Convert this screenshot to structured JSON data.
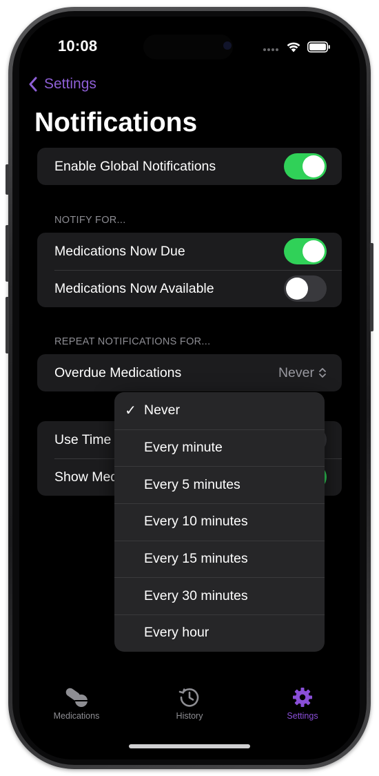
{
  "status_bar": {
    "time": "10:08"
  },
  "nav": {
    "back_label": "Settings",
    "title": "Notifications"
  },
  "global": {
    "enable_label": "Enable Global Notifications",
    "enabled": true
  },
  "notify_for": {
    "header": "NOTIFY FOR...",
    "items": [
      {
        "label": "Medications Now Due",
        "enabled": true
      },
      {
        "label": "Medications Now Available",
        "enabled": false
      }
    ]
  },
  "repeat": {
    "header": "REPEAT NOTIFICATIONS FOR...",
    "overdue_label": "Overdue Medications",
    "selected_value": "Never"
  },
  "other": {
    "items": [
      {
        "label": "Use Time",
        "enabled": false
      },
      {
        "label": "Show Med",
        "enabled": true
      }
    ]
  },
  "dropdown": {
    "options": [
      {
        "label": "Never",
        "selected": true
      },
      {
        "label": "Every minute",
        "selected": false
      },
      {
        "label": "Every 5 minutes",
        "selected": false
      },
      {
        "label": "Every 10 minutes",
        "selected": false
      },
      {
        "label": "Every 15 minutes",
        "selected": false
      },
      {
        "label": "Every 30 minutes",
        "selected": false
      },
      {
        "label": "Every hour",
        "selected": false
      }
    ],
    "check_glyph": "✓"
  },
  "tabbar": {
    "tabs": [
      {
        "label": "Medications",
        "icon": "pills-icon",
        "active": false
      },
      {
        "label": "History",
        "icon": "history-icon",
        "active": false
      },
      {
        "label": "Settings",
        "icon": "gear-icon",
        "active": true
      }
    ]
  },
  "colors": {
    "accent": "#8a4fd8",
    "toggle_on": "#30d158",
    "background": "#000000",
    "card": "#1c1c1e"
  }
}
